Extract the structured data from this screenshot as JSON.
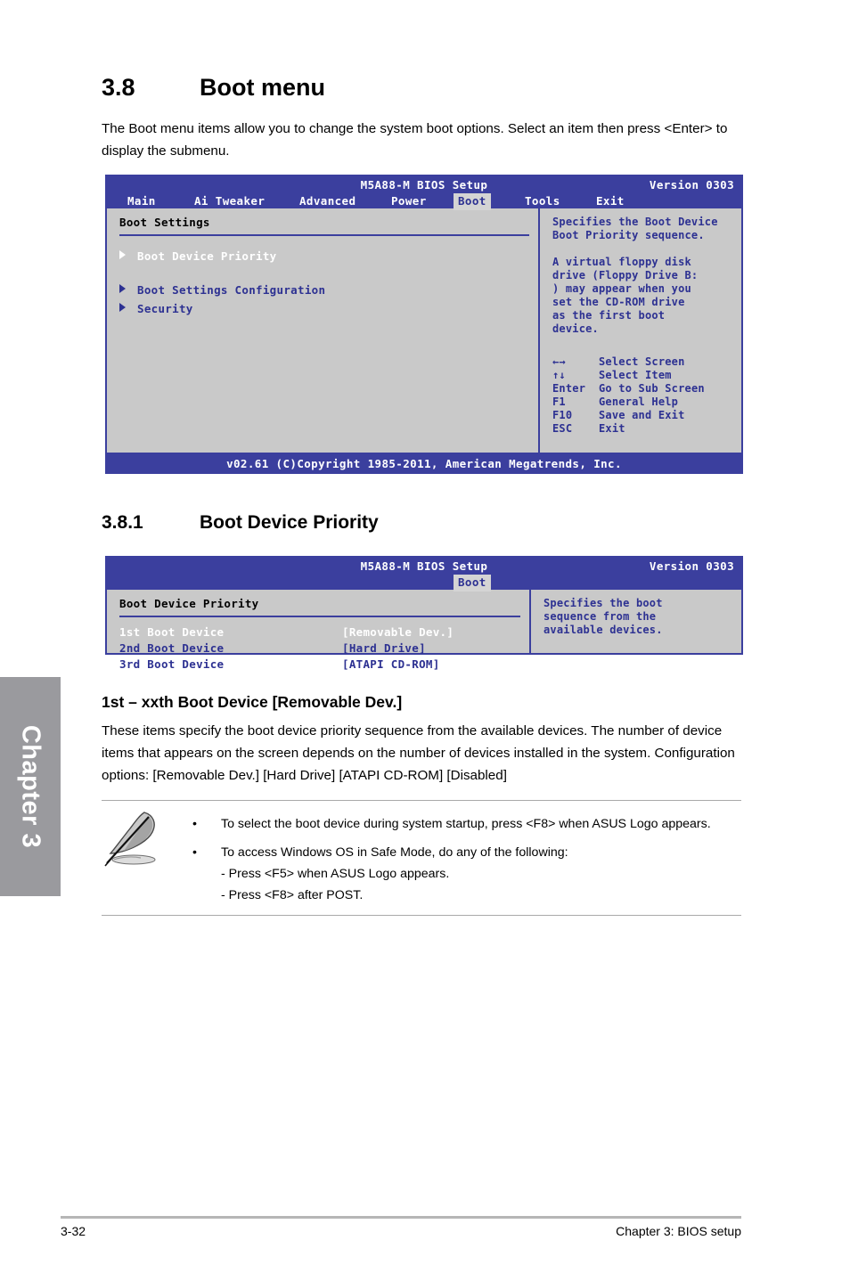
{
  "sidebar": {
    "chapter_tab": "Chapter 3"
  },
  "sections": {
    "s38": {
      "number": "3.8",
      "title": "Boot menu"
    },
    "s381": {
      "number": "3.8.1",
      "title": "Boot Device Priority"
    }
  },
  "intro_text": "The Boot menu items allow you to change the system boot options. Select an item then press <Enter> to display the submenu.",
  "bios1": {
    "title": "M5A88-M BIOS Setup",
    "version": "Version 0303",
    "tabs": [
      {
        "label": "Main",
        "active": false
      },
      {
        "label": "Ai Tweaker",
        "active": false
      },
      {
        "label": "Advanced",
        "active": false
      },
      {
        "label": "Power",
        "active": false
      },
      {
        "label": "Boot",
        "active": true
      },
      {
        "label": "Tools",
        "active": false
      },
      {
        "label": "Exit",
        "active": false
      }
    ],
    "section_title": "Boot Settings",
    "items": [
      {
        "label": "Boot Device Priority",
        "selected": true
      },
      {
        "label": "Boot Settings Configuration",
        "selected": false
      },
      {
        "label": "Security",
        "selected": false
      }
    ],
    "help_text": "Specifies the Boot Device\nBoot Priority sequence.\n\nA virtual floppy disk\ndrive (Floppy Drive B:\n) may appear when you\nset the CD-ROM drive\nas the first boot\ndevice.",
    "keys": [
      {
        "key": "←→",
        "action": "Select Screen"
      },
      {
        "key": "↑↓",
        "action": "Select Item"
      },
      {
        "key": "Enter",
        "action": "Go to Sub Screen"
      },
      {
        "key": "F1",
        "action": "General Help"
      },
      {
        "key": "F10",
        "action": "Save and Exit"
      },
      {
        "key": "ESC",
        "action": "Exit"
      }
    ],
    "footer": "v02.61 (C)Copyright 1985-2011, American Megatrends, Inc."
  },
  "bios2": {
    "title": "M5A88-M BIOS Setup",
    "version": "Version 0303",
    "tabs": [
      {
        "label": "Boot",
        "active": true
      }
    ],
    "section_title": "Boot Device Priority",
    "rows": [
      {
        "name": "1st Boot Device",
        "value": "[Removable Dev.]",
        "selected": true
      },
      {
        "name": "2nd Boot Device",
        "value": "[Hard Drive]",
        "selected": false
      },
      {
        "name": "3rd Boot Device",
        "value": "[ATAPI CD-ROM]",
        "selected": false
      }
    ],
    "help_text": "Specifies the boot\nsequence from the\navailable devices."
  },
  "subsection": {
    "heading": "1st – xxth Boot Device [Removable Dev.]",
    "description": "These items specify the boot device priority sequence from the available devices. The number of device items that appears on the screen depends on the number of devices installed in the system. Configuration options: [Removable Dev.] [Hard Drive] [ATAPI CD-ROM] [Disabled]"
  },
  "note": {
    "icon": "quill-pen-icon",
    "bullet_symbol": "•",
    "bullets": [
      "To select the boot device during system startup, press <F8> when ASUS Logo appears.",
      "To access Windows OS in Safe Mode, do any of the following:"
    ],
    "sub_items": [
      "- Press <F5> when ASUS Logo appears.",
      "- Press <F8> after POST."
    ]
  },
  "footer": {
    "page_number": "3-32",
    "chapter_label": "Chapter 3: BIOS setup"
  },
  "colors": {
    "bios_blue": "#3b3f9e",
    "bios_text_blue": "#2d3192",
    "bios_panel_gray": "#c9c9c9",
    "tab_active_gray": "#d4d4d4",
    "chapter_tab_gray": "#9a9a9e"
  }
}
